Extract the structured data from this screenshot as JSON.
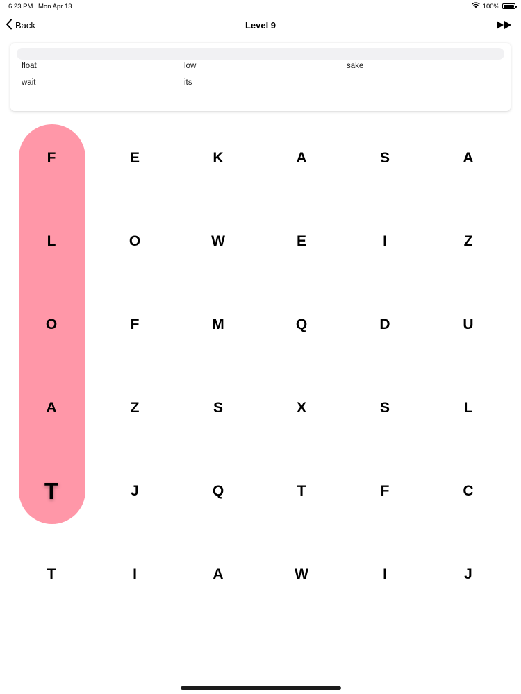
{
  "status_bar": {
    "time": "6:23 PM",
    "date": "Mon Apr 13",
    "battery": "100%",
    "icons": [
      "wifi-icon",
      "battery-icon"
    ]
  },
  "nav": {
    "back_label": "Back",
    "title": "Level 9",
    "icons": [
      "chevron-left-icon",
      "fast-forward-icon"
    ]
  },
  "words": [
    "float",
    "low",
    "sake",
    "wait",
    "its"
  ],
  "grid": [
    [
      "F",
      "E",
      "K",
      "A",
      "S",
      "A"
    ],
    [
      "L",
      "O",
      "W",
      "E",
      "I",
      "Z"
    ],
    [
      "O",
      "F",
      "M",
      "Q",
      "D",
      "U"
    ],
    [
      "A",
      "Z",
      "S",
      "X",
      "S",
      "L"
    ],
    [
      "T",
      "J",
      "Q",
      "T",
      "F",
      "C"
    ],
    [
      "T",
      "I",
      "A",
      "W",
      "I",
      "J"
    ]
  ],
  "selection": {
    "word": "FLOAT",
    "cells": [
      [
        0,
        0
      ],
      [
        1,
        0
      ],
      [
        2,
        0
      ],
      [
        3,
        0
      ],
      [
        4,
        0
      ]
    ],
    "color": "#ff97a8"
  },
  "colors": {
    "highlight": "#ff97a8",
    "progress_track": "#f1f1f3"
  }
}
